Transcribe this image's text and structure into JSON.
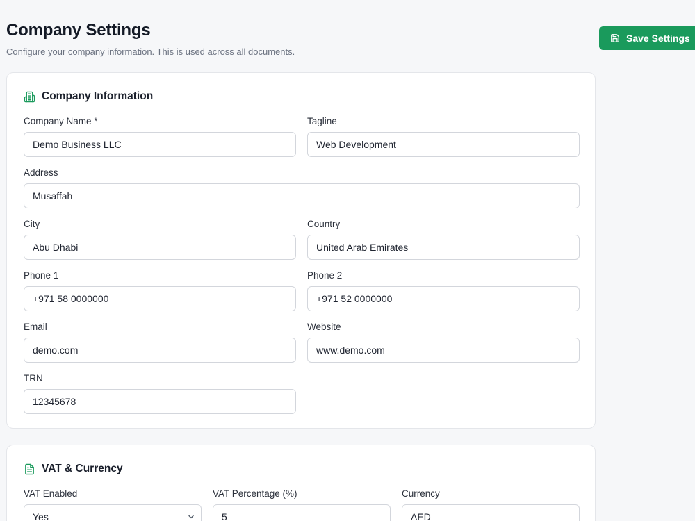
{
  "header": {
    "title": "Company Settings",
    "subtitle": "Configure your company information. This is used across all documents."
  },
  "actions": {
    "save_label": "Save Settings",
    "save_icon": "save-icon"
  },
  "company_info": {
    "title": "Company Information",
    "icon": "building-icon",
    "fields": {
      "company_name": {
        "label": "Company Name *",
        "value": "Demo Business LLC"
      },
      "tagline": {
        "label": "Tagline",
        "value": "Web Development"
      },
      "address": {
        "label": "Address",
        "value": "Musaffah"
      },
      "city": {
        "label": "City",
        "value": "Abu Dhabi"
      },
      "country": {
        "label": "Country",
        "value": "United Arab Emirates"
      },
      "phone1": {
        "label": "Phone 1",
        "value": "+971 58 0000000"
      },
      "phone2": {
        "label": "Phone 2",
        "value": "+971 52 0000000"
      },
      "email": {
        "label": "Email",
        "value": "demo.com"
      },
      "website": {
        "label": "Website",
        "value": "www.demo.com"
      },
      "trn": {
        "label": "TRN",
        "value": "12345678"
      }
    }
  },
  "vat_currency": {
    "title": "VAT & Currency",
    "icon": "document-icon",
    "fields": {
      "vat_enabled": {
        "label": "VAT Enabled",
        "value": "Yes"
      },
      "vat_percentage": {
        "label": "VAT Percentage (%)",
        "value": "5"
      },
      "currency": {
        "label": "Currency",
        "value": "AED"
      }
    }
  },
  "colors": {
    "accent": "#1a9a5c",
    "background": "#f6f7f9",
    "card_border": "#e4e6ea"
  }
}
